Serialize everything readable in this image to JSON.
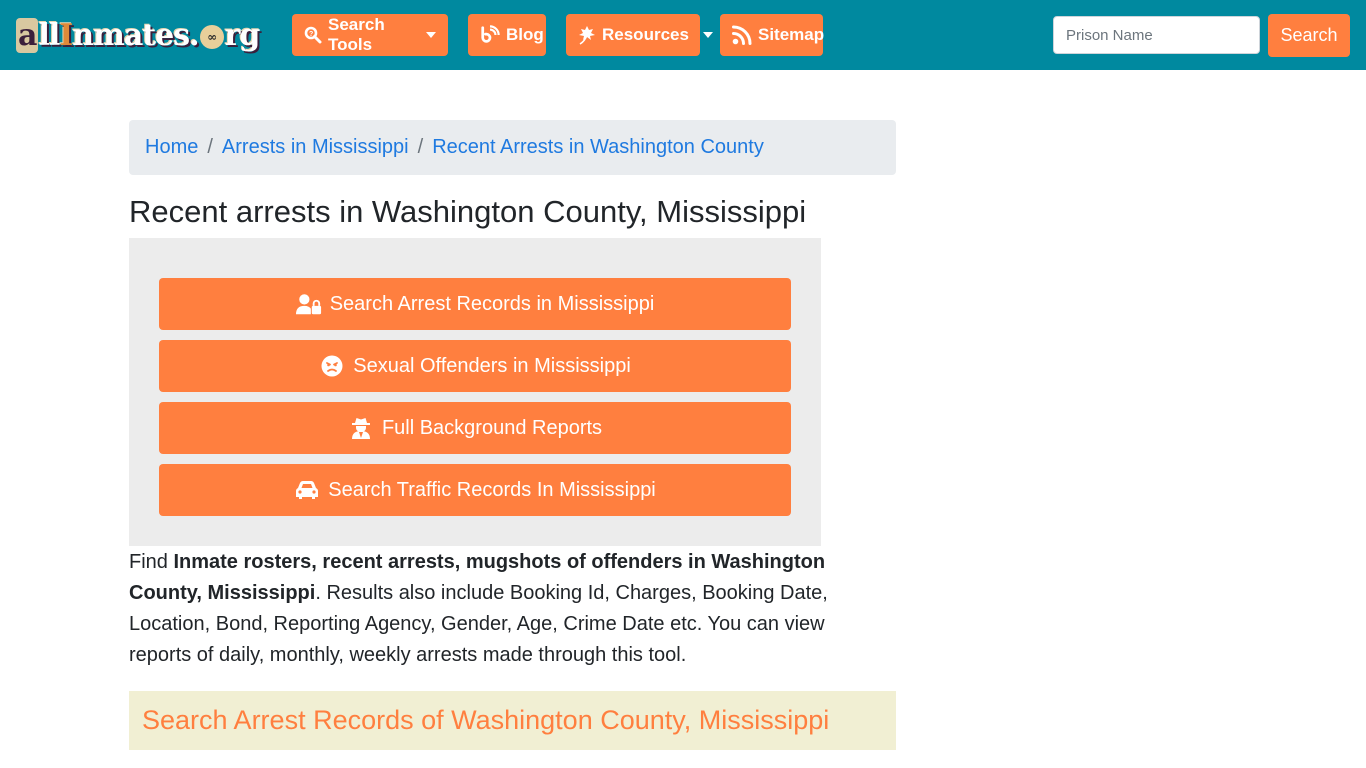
{
  "header": {
    "logo": {
      "prefix": "a",
      "part1": "ll",
      "part2": "I",
      "part3": "nmates",
      "badge": "∞",
      "suffix": "rg"
    },
    "nav": [
      {
        "label": "Search Tools",
        "icon": "search-icon",
        "dropdown": true
      },
      {
        "label": "Blog",
        "icon": "blogger-icon",
        "dropdown": false
      },
      {
        "label": "Resources",
        "icon": "leaf-icon",
        "dropdown": true
      },
      {
        "label": "Sitemap",
        "icon": "rss-icon",
        "dropdown": false
      }
    ],
    "search": {
      "placeholder": "Prison Name",
      "value": "",
      "button_label": "Search"
    }
  },
  "breadcrumb": {
    "items": [
      "Home",
      "Arrests in Mississippi",
      "Recent Arrests in Washington County"
    ],
    "separator": "/"
  },
  "main": {
    "title": "Recent arrests in Washington County, Mississippi",
    "tool_buttons": [
      {
        "label": "Search Arrest Records in Mississippi",
        "icon": "user-lock-icon"
      },
      {
        "label": "Sexual Offenders in Mississippi",
        "icon": "angry-face-icon"
      },
      {
        "label": "Full Background Reports",
        "icon": "user-secret-icon"
      },
      {
        "label": "Search Traffic Records In Mississippi",
        "icon": "car-icon"
      }
    ],
    "description": {
      "lead": "Find ",
      "bold": "Inmate rosters, recent arrests, mugshots of offenders in Washington County, Mississippi",
      "rest": ". Results also include Booking Id, Charges, Booking Date, Location, Bond, Reporting Agency, Gender, Age, Crime Date etc. You can view reports of daily, monthly, weekly arrests made through this tool."
    },
    "section_heading": "Search Arrest Records of Washington County, Mississippi"
  },
  "colors": {
    "navbar": "#00899f",
    "accent": "#ff7f3f",
    "link": "#1f7ae0",
    "breadcrumb_bg": "#e9ecef",
    "tool_box_bg": "#ececec",
    "section_bg": "#f1efd3"
  }
}
